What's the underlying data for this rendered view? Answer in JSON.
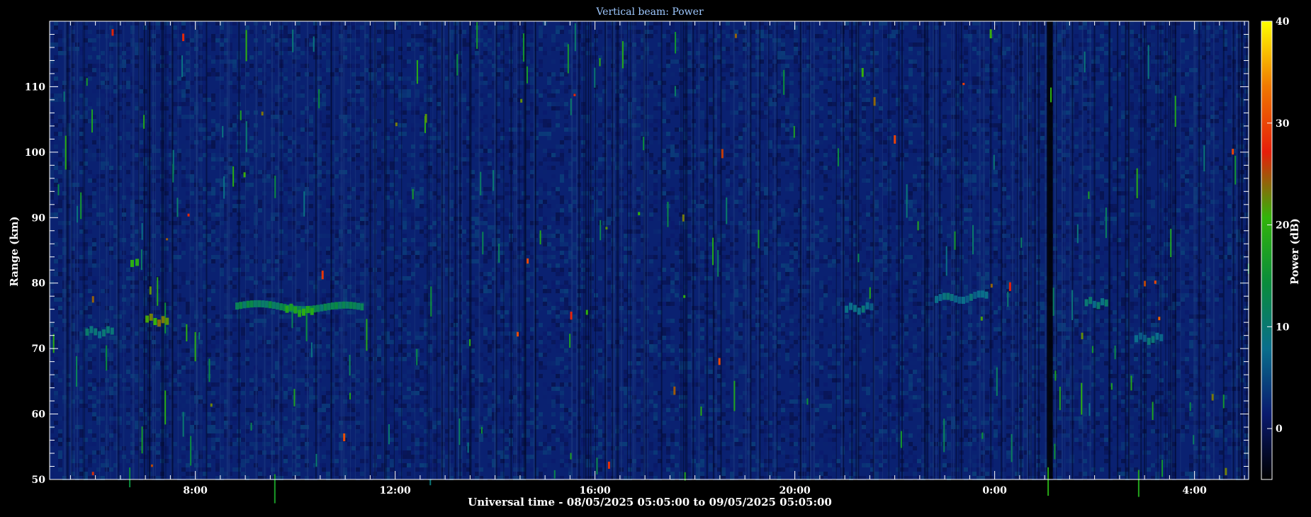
{
  "chart_data": {
    "type": "heatmap",
    "title": "Vertical beam: Power",
    "ylabel": "Range (km)",
    "xlabel": "Universal time - 08/05/2025 05:05:00 to 09/05/2025 05:05:00",
    "colorbar_label": "Power (dB)",
    "ylim": [
      50,
      120
    ],
    "y_ticks": [
      50,
      60,
      70,
      80,
      90,
      100,
      110
    ],
    "y_tick_labels": [
      "50",
      "60",
      "70",
      "80",
      "90",
      "100",
      "110"
    ],
    "x_ticks_hours": [
      8,
      12,
      16,
      20,
      24,
      28
    ],
    "x_tick_labels": [
      "8:00",
      "12:00",
      "16:00",
      "20:00",
      "0:00",
      "4:00"
    ],
    "xlim_hours": [
      5.0833,
      29.0833
    ],
    "colorbar_ticks": [
      0,
      10,
      20,
      30,
      40
    ],
    "colorbar_tick_labels": [
      "0",
      "10",
      "20",
      "30",
      "40"
    ],
    "colorbar_range": [
      -5,
      40
    ],
    "colorbar_colors": [
      "#000000",
      "#0a1a6e",
      "#0a6e8c",
      "#0a8c3c",
      "#32b40a",
      "#e61e0a",
      "#f07800",
      "#ffff00"
    ],
    "background_level_db": 2,
    "features": [
      {
        "name": "echo layer",
        "x": [
          8.8,
          11.3
        ],
        "y": [
          76.5,
          76.2
        ],
        "power_db": 12
      },
      {
        "name": "echo layer",
        "x": [
          9.8,
          10.3
        ],
        "y": [
          76.0,
          75.5
        ],
        "power_db": 18
      },
      {
        "name": "echo layer",
        "x": [
          5.8,
          6.3
        ],
        "y": [
          72.5,
          72.5
        ],
        "power_db": 10
      },
      {
        "name": "echo layer",
        "x": [
          6.7,
          6.8
        ],
        "y": [
          83.0,
          83.0
        ],
        "power_db": 20
      },
      {
        "name": "echo layer",
        "x": [
          7.0,
          7.4
        ],
        "y": [
          74.5,
          74.0
        ],
        "power_db": 22
      },
      {
        "name": "echo layer",
        "x": [
          21.0,
          21.5
        ],
        "y": [
          76.0,
          76.2
        ],
        "power_db": 8
      },
      {
        "name": "echo layer",
        "x": [
          22.8,
          23.8
        ],
        "y": [
          77.5,
          78.0
        ],
        "power_db": 8
      },
      {
        "name": "echo layer",
        "x": [
          25.8,
          26.2
        ],
        "y": [
          77.0,
          76.8
        ],
        "power_db": 9
      },
      {
        "name": "echo layer",
        "x": [
          26.8,
          27.3
        ],
        "y": [
          71.5,
          71.5
        ],
        "power_db": 8
      }
    ]
  }
}
